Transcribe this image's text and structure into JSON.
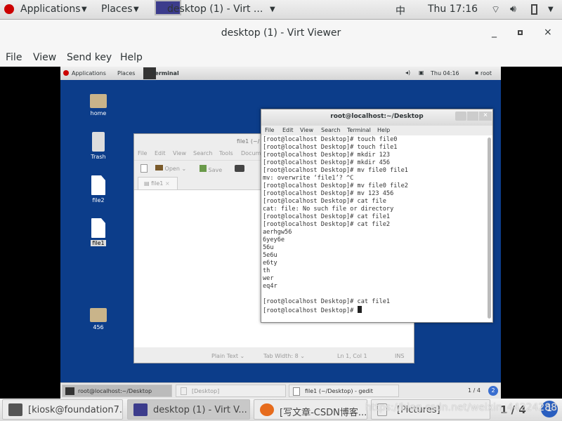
{
  "host_topbar": {
    "applications": "Applications",
    "places": "Places",
    "window": "desktop (1) - Virt ...",
    "input": "中",
    "clock": "Thu 17:16"
  },
  "viewer": {
    "title": "desktop (1) - Virt Viewer",
    "menu": [
      "File",
      "View",
      "Send key",
      "Help"
    ]
  },
  "guest_topbar": {
    "applications": "Applications",
    "places": "Places",
    "window": "Terminal",
    "clock": "Thu 04:16",
    "user": "root"
  },
  "desktop_icons": [
    "home",
    "Trash",
    "file2",
    "file1",
    "456"
  ],
  "gedit": {
    "title": "file1 (~/",
    "menu": [
      "File",
      "Edit",
      "View",
      "Search",
      "Tools",
      "Docum"
    ],
    "toolbar": {
      "open": "Open",
      "save": "Save"
    },
    "tab": "file1",
    "status": {
      "syntax": "Plain Text",
      "tab_width": "Tab Width:  8",
      "position": "Ln 1, Col 1",
      "mode": "INS"
    }
  },
  "terminal": {
    "title": "root@localhost:~/Desktop",
    "menu": [
      "File",
      "Edit",
      "View",
      "Search",
      "Terminal",
      "Help"
    ],
    "lines": [
      "[root@localhost Desktop]# touch file0",
      "[root@localhost Desktop]# touch file1",
      "[root@localhost Desktop]# mkdir 123",
      "[root@localhost Desktop]# mkdir 456",
      "[root@localhost Desktop]# mv file0 file1",
      "mv: overwrite ‘file1’? ^C",
      "[root@localhost Desktop]# mv file0 file2",
      "[root@localhost Desktop]# mv 123 456",
      "[root@localhost Desktop]# cat file",
      "cat: file: No such file or directory",
      "[root@localhost Desktop]# cat file1",
      "[root@localhost Desktop]# cat file2",
      "aerhgw56",
      "6yey6e",
      "56u",
      "5e6u",
      "e6ty",
      "th",
      "wer",
      "eq4r",
      "",
      "[root@localhost Desktop]# cat file1"
    ],
    "prompt": "[root@localhost Desktop]# "
  },
  "guest_taskbar": {
    "items": [
      "root@localhost:~/Desktop",
      "[Desktop]",
      "file1 (~/Desktop) - gedit"
    ],
    "workspace": "1 / 4",
    "badge": "2"
  },
  "host_taskbar": {
    "items": [
      "[kiosk@foundation7...",
      "desktop (1) - Virt V...",
      "[写文章-CSDN博客...",
      "[Pictures]"
    ],
    "workspace": "1 / 4",
    "badge": "1",
    "watermark": "https://blog.csdn.net/weixin_44224288"
  },
  "colors": {
    "guest_desktop": "#0c3d8a",
    "redhat": "#cc0000"
  }
}
